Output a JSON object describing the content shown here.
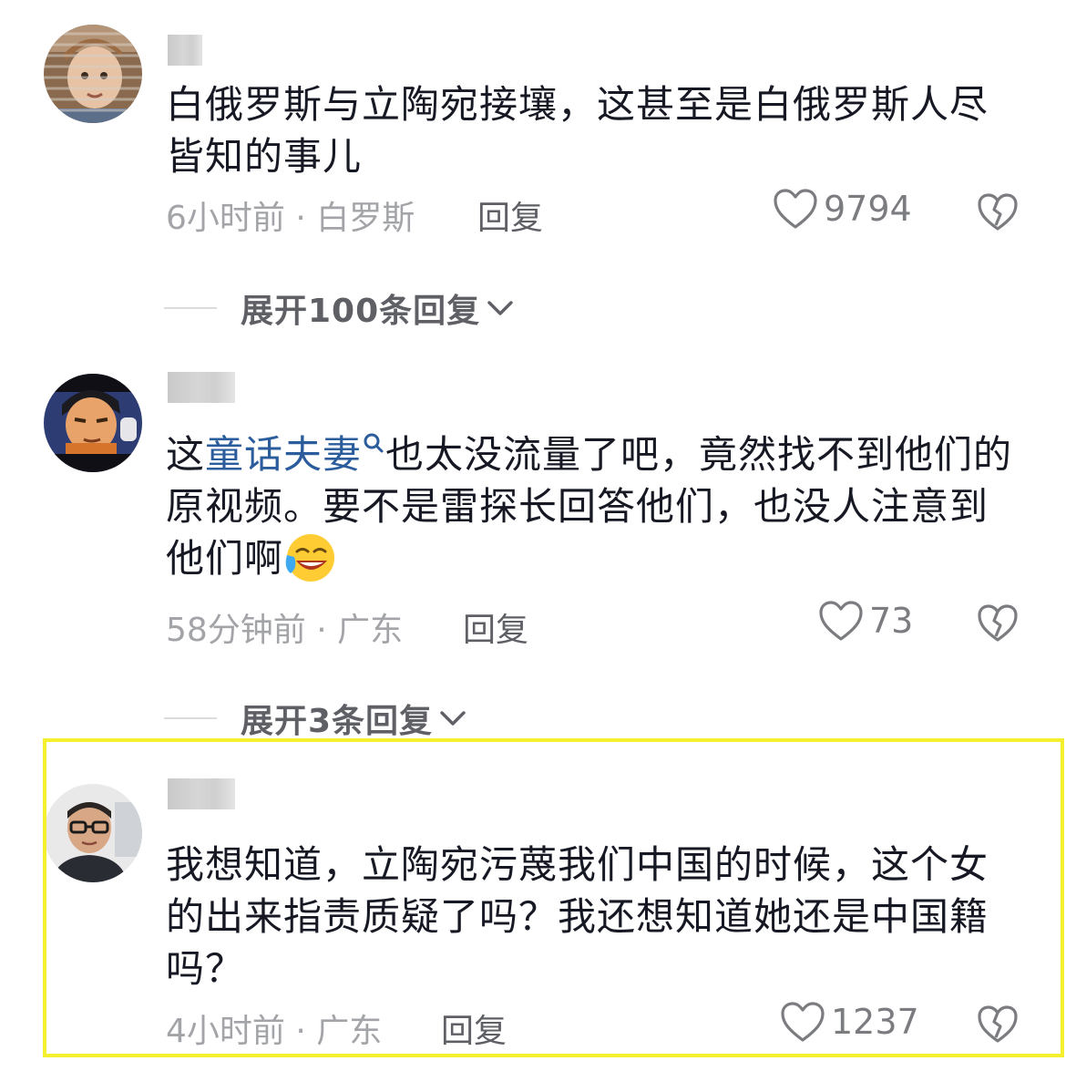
{
  "comments": [
    {
      "text": "白俄罗斯与立陶宛接壤，这甚至是白俄罗斯人尽皆知的事儿",
      "time": "6小时前 · 白罗斯",
      "reply_label": "回复",
      "likes": "9794",
      "expand_label": "展开100条回复"
    },
    {
      "text_before": "这",
      "text_link": "童话夫妻",
      "text_after": "也太没流量了吧，竟然找不到他们的原视频。要不是雷探长回答他们，也没人注意到他们啊",
      "emoji": "laughing-crying-emoji",
      "time": "58分钟前 · 广东",
      "reply_label": "回复",
      "likes": "73",
      "expand_label": "展开3条回复"
    },
    {
      "text": "我想知道，立陶宛污蔑我们中国的时候，这个女的出来指责质疑了吗？我还想知道她还是中国籍吗？",
      "time": "4小时前 · 广东",
      "reply_label": "回复",
      "likes": "1237"
    }
  ],
  "colors": {
    "text": "#161823",
    "meta": "#a3a4a8",
    "link": "#2b5d9c",
    "highlight": "#f4f02f"
  }
}
